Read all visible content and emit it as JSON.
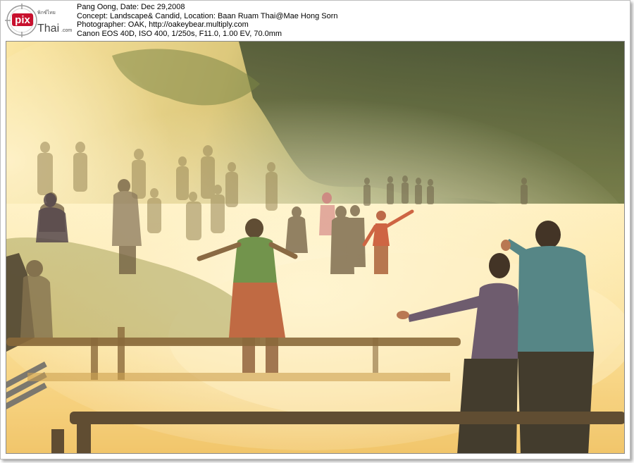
{
  "caption": {
    "line1": "Pang Oong, Date: Dec 29,2008",
    "line2": "Concept: Landscape& Candid, Location: Baan Ruam Thai@Mae Hong Sorn",
    "line3": "Photographer: OAK, http://oakeybear.multiply.com",
    "line4": "Canon EOS 40D, ISO 400, 1/250s, F11.0, 1.00 EV, 70.0mm"
  },
  "logo": {
    "pix_text": "pix",
    "brand_text": "Thai",
    "suffix_text": ".com",
    "thai_script_text": "พิกซ์ไทย",
    "accent_color": "#c8102e"
  },
  "photo": {
    "subject": "misty lake at sunrise with silhouetted people and wooden railings",
    "palette": {
      "mist": "#fff4c8",
      "gold": "#f2c65a",
      "forest": "#3b4a2a",
      "shadow": "#2a241c"
    }
  }
}
